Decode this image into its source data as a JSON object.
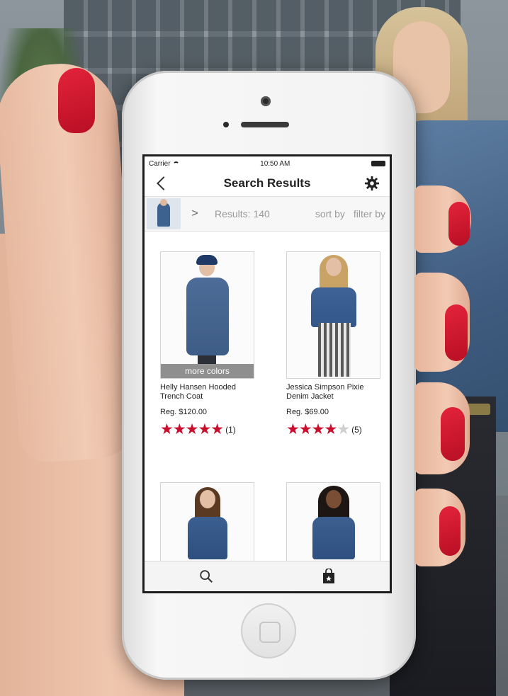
{
  "status_bar": {
    "carrier": "Carrier",
    "time": "10:50 AM"
  },
  "nav": {
    "title": "Search Results"
  },
  "filter_bar": {
    "results_text": "Results: 140",
    "sort_label": "sort by",
    "filter_label": "filter by"
  },
  "products": [
    {
      "name": "Helly Hansen Hooded Trench Coat",
      "price": "Reg. $120.00",
      "rating": 5,
      "rating_count": "(1)",
      "badge": "more colors"
    },
    {
      "name": "Jessica Simpson Pixie Denim Jacket",
      "price": "Reg. $69.00",
      "rating": 4.5,
      "rating_count": "(5)"
    },
    {
      "name": "",
      "price": ""
    },
    {
      "name": "",
      "price": ""
    }
  ],
  "tab_bar": {
    "tabs": [
      "search-icon",
      "shopping-bag-icon"
    ]
  },
  "colors": {
    "accent_red": "#c8102e",
    "nail_red": "#d91a30"
  }
}
